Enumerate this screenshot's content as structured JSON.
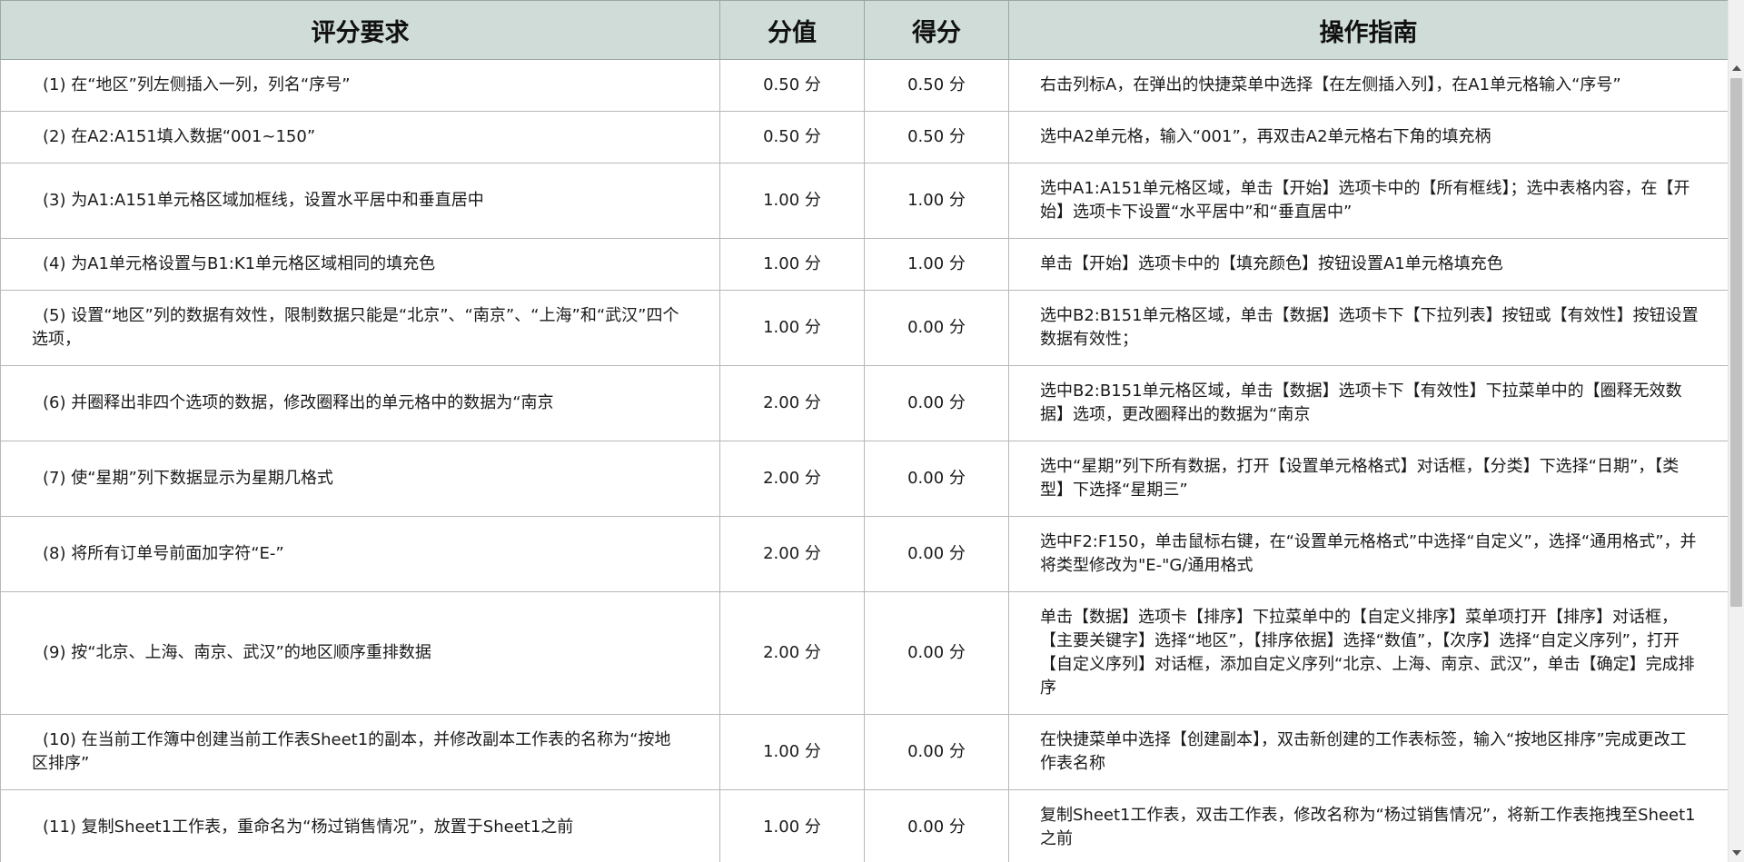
{
  "header": {
    "requirement": "评分要求",
    "value": "分值",
    "score": "得分",
    "guide": "操作指南"
  },
  "rows": [
    {
      "requirement": "(1) 在“地区”列左侧插入一列，列名“序号”",
      "value": "0.50 分",
      "score": "0.50 分",
      "guide": "右击列标A，在弹出的快捷菜单中选择【在左侧插入列】，在A1单元格输入“序号”"
    },
    {
      "requirement": "(2) 在A2:A151填入数据“001~150”",
      "value": "0.50 分",
      "score": "0.50 分",
      "guide": "选中A2单元格，输入“001”，再双击A2单元格右下角的填充柄"
    },
    {
      "requirement": "(3) 为A1:A151单元格区域加框线，设置水平居中和垂直居中",
      "value": "1.00 分",
      "score": "1.00 分",
      "guide": "选中A1:A151单元格区域，单击【开始】选项卡中的【所有框线】；选中表格内容，在【开始】选项卡下设置“水平居中”和“垂直居中”"
    },
    {
      "requirement": "(4) 为A1单元格设置与B1:K1单元格区域相同的填充色",
      "value": "1.00 分",
      "score": "1.00 分",
      "guide": "单击【开始】选项卡中的【填充颜色】按钮设置A1单元格填充色"
    },
    {
      "requirement": "(5) 设置“地区”列的数据有效性，限制数据只能是“北京”、“南京”、“上海”和“武汉”四个选项，",
      "value": "1.00 分",
      "score": "0.00 分",
      "guide": "选中B2:B151单元格区域，单击【数据】选项卡下【下拉列表】按钮或【有效性】按钮设置数据有效性；"
    },
    {
      "requirement": "(6) 并圈释出非四个选项的数据，修改圈释出的单元格中的数据为“南京",
      "value": "2.00 分",
      "score": "0.00 分",
      "guide": "选中B2:B151单元格区域，单击【数据】选项卡下【有效性】下拉菜单中的【圈释无效数据】选项，更改圈释出的数据为“南京"
    },
    {
      "requirement": "(7) 使“星期”列下数据显示为星期几格式",
      "value": "2.00 分",
      "score": "0.00 分",
      "guide": "选中“星期”列下所有数据，打开【设置单元格格式】对话框，【分类】下选择“日期”，【类型】下选择“星期三”"
    },
    {
      "requirement": "(8) 将所有订单号前面加字符“E-”",
      "value": "2.00 分",
      "score": "0.00 分",
      "guide": "选中F2:F150，单击鼠标右键，在“设置单元格格式”中选择“自定义”，选择“通用格式”，并将类型修改为\"E-\"G/通用格式"
    },
    {
      "requirement": "(9) 按“北京、上海、南京、武汉”的地区顺序重排数据",
      "value": "2.00 分",
      "score": "0.00 分",
      "guide": "单击【数据】选项卡【排序】下拉菜单中的【自定义排序】菜单项打开【排序】对话框，【主要关键字】选择“地区”，【排序依据】选择“数值”，【次序】选择“自定义序列”，打开【自定义序列】对话框，添加自定义序列“北京、上海、南京、武汉”，单击【确定】完成排序"
    },
    {
      "requirement": "(10) 在当前工作簿中创建当前工作表Sheet1的副本，并修改副本工作表的名称为“按地区排序”",
      "value": "1.00 分",
      "score": "0.00 分",
      "guide": "在快捷菜单中选择【创建副本】，双击新创建的工作表标签，输入“按地区排序”完成更改工作表名称"
    },
    {
      "requirement": "(11) 复制Sheet1工作表，重命名为“杨过销售情况”，放置于Sheet1之前",
      "value": "1.00 分",
      "score": "0.00 分",
      "guide": "复制Sheet1工作表，双击工作表，修改名称为“杨过销售情况”，将新工作表拖拽至Sheet1之前"
    }
  ],
  "colors": {
    "header_bg": "#cfdcd8",
    "grid": "#b8b8b8"
  }
}
